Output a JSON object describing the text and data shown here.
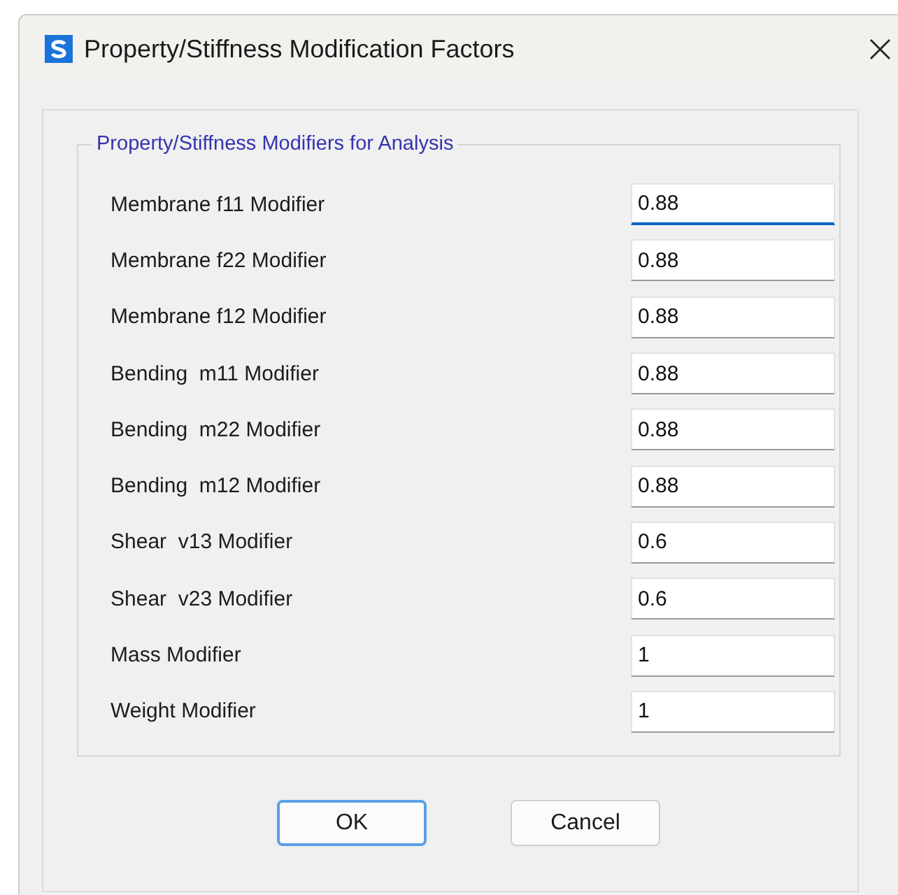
{
  "window": {
    "title": "Property/Stiffness Modification Factors",
    "close": "×"
  },
  "group": {
    "title": "Property/Stiffness Modifiers for Analysis"
  },
  "fields": [
    {
      "label": "Membrane f11 Modifier",
      "value": "0.88",
      "focused": true
    },
    {
      "label": "Membrane f22 Modifier",
      "value": "0.88",
      "focused": false
    },
    {
      "label": "Membrane f12 Modifier",
      "value": "0.88",
      "focused": false
    },
    {
      "label": "Bending  m11 Modifier",
      "value": "0.88",
      "focused": false
    },
    {
      "label": "Bending  m22 Modifier",
      "value": "0.88",
      "focused": false
    },
    {
      "label": "Bending  m12 Modifier",
      "value": "0.88",
      "focused": false
    },
    {
      "label": "Shear  v13 Modifier",
      "value": "0.6",
      "focused": false
    },
    {
      "label": "Shear  v23 Modifier",
      "value": "0.6",
      "focused": false
    },
    {
      "label": "Mass Modifier",
      "value": "1",
      "focused": false
    },
    {
      "label": "Weight Modifier",
      "value": "1",
      "focused": false
    }
  ],
  "buttons": [
    {
      "label": "OK",
      "default": true
    },
    {
      "label": "Cancel",
      "default": false
    }
  ]
}
